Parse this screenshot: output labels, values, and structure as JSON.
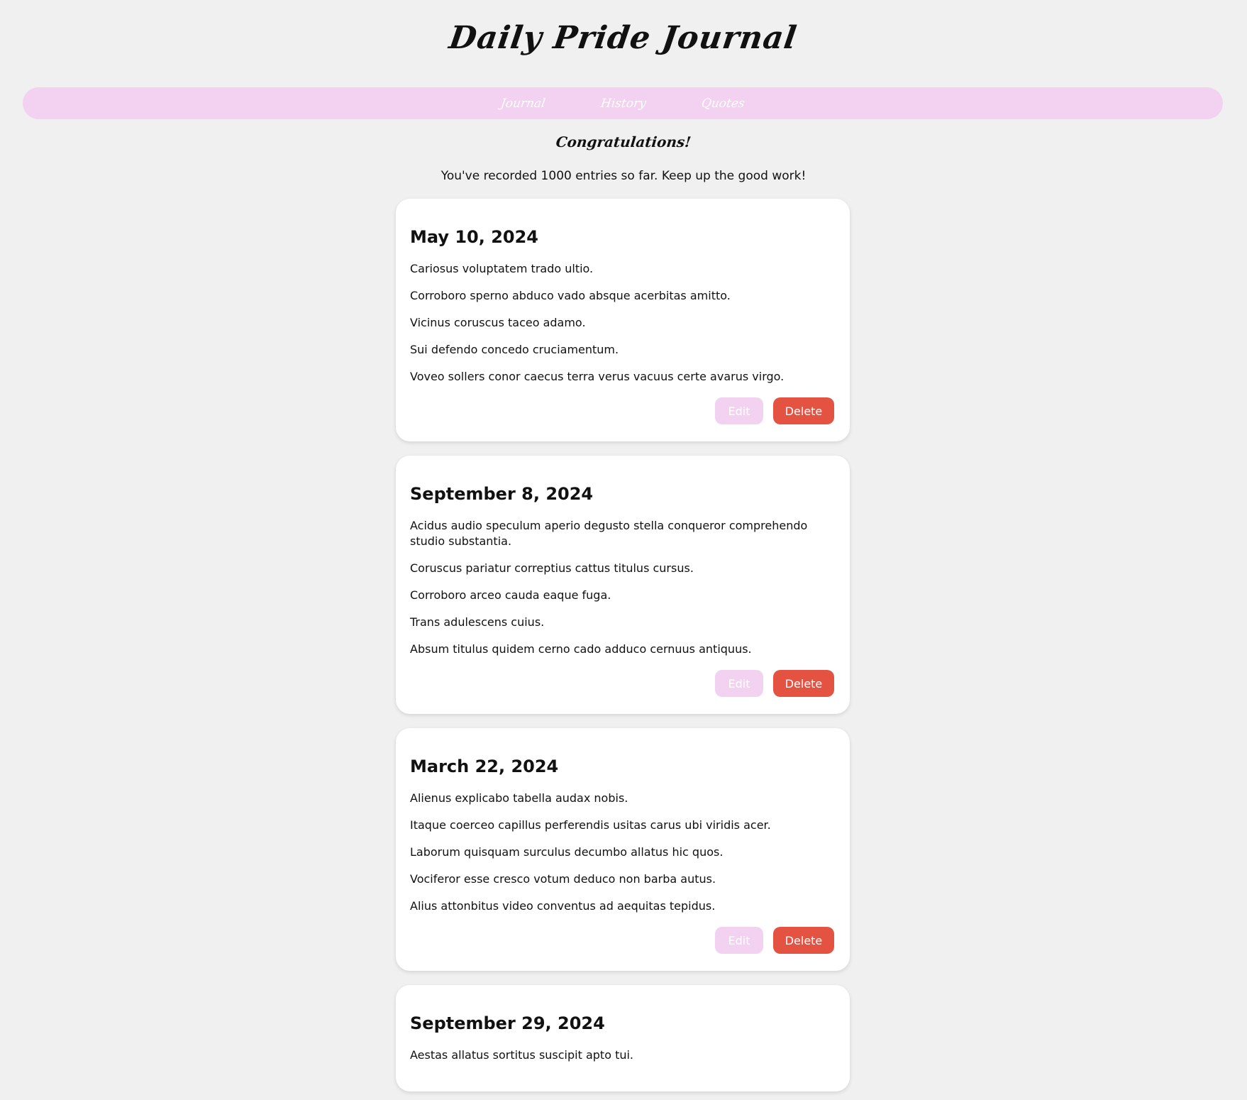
{
  "app": {
    "title": "Daily Pride Journal"
  },
  "nav": {
    "items": [
      {
        "label": "Journal"
      },
      {
        "label": "History"
      },
      {
        "label": "Quotes"
      }
    ]
  },
  "congrats": {
    "heading": "Congratulations!",
    "text": "You've recorded 1000 entries so far. Keep up the good work!"
  },
  "buttons": {
    "edit_label": "Edit",
    "delete_label": "Delete"
  },
  "colors": {
    "nav_bg": "#f3d1f0",
    "edit_bg": "#f3d1f0",
    "delete_bg": "#e45341",
    "page_bg": "#f0f0f0"
  },
  "entries": [
    {
      "date": "May 10, 2024",
      "lines": [
        "Cariosus voluptatem trado ultio.",
        "Corroboro sperno abduco vado absque acerbitas amitto.",
        "Vicinus coruscus taceo adamo.",
        "Sui defendo concedo cruciamentum.",
        "Voveo sollers conor caecus terra verus vacuus certe avarus virgo."
      ]
    },
    {
      "date": "September 8, 2024",
      "lines": [
        "Acidus audio speculum aperio degusto stella conqueror comprehendo studio substantia.",
        "Coruscus pariatur correptius cattus titulus cursus.",
        "Corroboro arceo cauda eaque fuga.",
        "Trans adulescens cuius.",
        "Absum titulus quidem cerno cado adduco cernuus antiquus."
      ]
    },
    {
      "date": "March 22, 2024",
      "lines": [
        "Alienus explicabo tabella audax nobis.",
        "Itaque coerceo capillus perferendis usitas carus ubi viridis acer.",
        "Laborum quisquam surculus decumbo allatus hic quos.",
        "Vociferor esse cresco votum deduco non barba autus.",
        "Alius attonbitus video conventus ad aequitas tepidus."
      ]
    },
    {
      "date": "September 29, 2024",
      "lines": [
        "Aestas allatus sortitus suscipit apto tui."
      ]
    }
  ]
}
